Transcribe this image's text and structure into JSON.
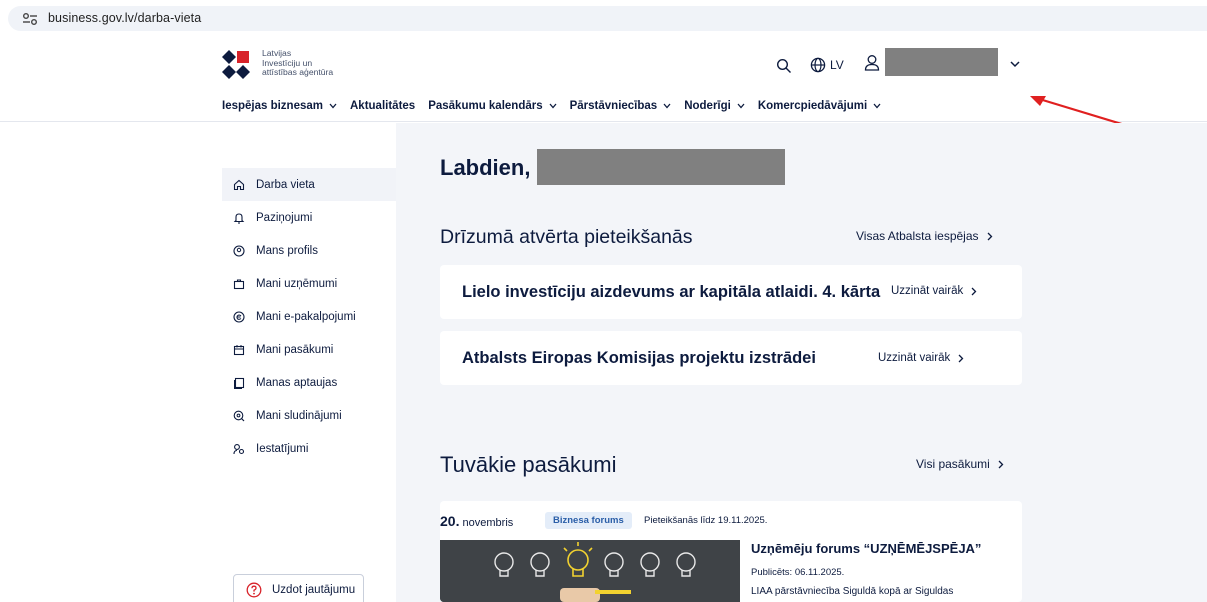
{
  "browser": {
    "url": "business.gov.lv/darba-vieta"
  },
  "header": {
    "logo_lines": [
      "Latvijas",
      "Investīciju un",
      "attīstības aģentūra"
    ],
    "language": "LV",
    "nav": [
      {
        "label": "Iespējas biznesam",
        "has_dropdown": true
      },
      {
        "label": "Aktualitātes",
        "has_dropdown": false
      },
      {
        "label": "Pasākumu kalendārs",
        "has_dropdown": true
      },
      {
        "label": "Pārstāvniecības",
        "has_dropdown": true
      },
      {
        "label": "Noderīgi",
        "has_dropdown": true
      },
      {
        "label": "Komercpiedāvājumi",
        "has_dropdown": true
      }
    ]
  },
  "sidebar": {
    "items": [
      {
        "label": "Darba vieta",
        "icon": "home-icon",
        "active": true
      },
      {
        "label": "Paziņojumi",
        "icon": "bell-icon",
        "active": false
      },
      {
        "label": "Mans profils",
        "icon": "profile-icon",
        "active": false
      },
      {
        "label": "Mani uzņēmumi",
        "icon": "briefcase-icon",
        "active": false
      },
      {
        "label": "Mani e-pakalpojumi",
        "icon": "eservice-icon",
        "active": false
      },
      {
        "label": "Mani pasākumi",
        "icon": "calendar-icon",
        "active": false
      },
      {
        "label": "Manas aptaujas",
        "icon": "survey-icon",
        "active": false
      },
      {
        "label": "Mani sludinājumi",
        "icon": "ads-icon",
        "active": false
      },
      {
        "label": "Iestatījumi",
        "icon": "settings-icon",
        "active": false
      }
    ],
    "ask_button": "Uzdot jautājumu"
  },
  "main": {
    "greeting": "Labdien,",
    "opening_section": {
      "title": "Drīzumā atvērta pieteikšanās",
      "link": "Visas Atbalsta iespējas",
      "cards": [
        {
          "title": "Lielo investīciju aizdevums ar kapitāla atlaidi. 4. kārta",
          "link": "Uzzināt vairāk"
        },
        {
          "title": "Atbalsts Eiropas Komisijas projektu izstrādei",
          "link": "Uzzināt vairāk"
        }
      ]
    },
    "events_section": {
      "title": "Tuvākie pasākumi",
      "link": "Visi pasākumi",
      "event": {
        "day": "20.",
        "month": "novembris",
        "badge": "Biznesa forums",
        "deadline": "Pieteikšanās līdz 19.11.2025.",
        "title": "Uzņēmēju forums “UZŅĒMĒJSPĒJA”",
        "published": "Publicēts: 06.11.2025.",
        "description": "LIAA pārstāvniecība Siguldā kopā ar Siguldas"
      }
    }
  },
  "colors": {
    "brand_navy": "#0d1b3e",
    "content_bg": "#f3f5f9",
    "badge_bg": "#e4edf9",
    "annotation_arrow": "#e02020"
  }
}
